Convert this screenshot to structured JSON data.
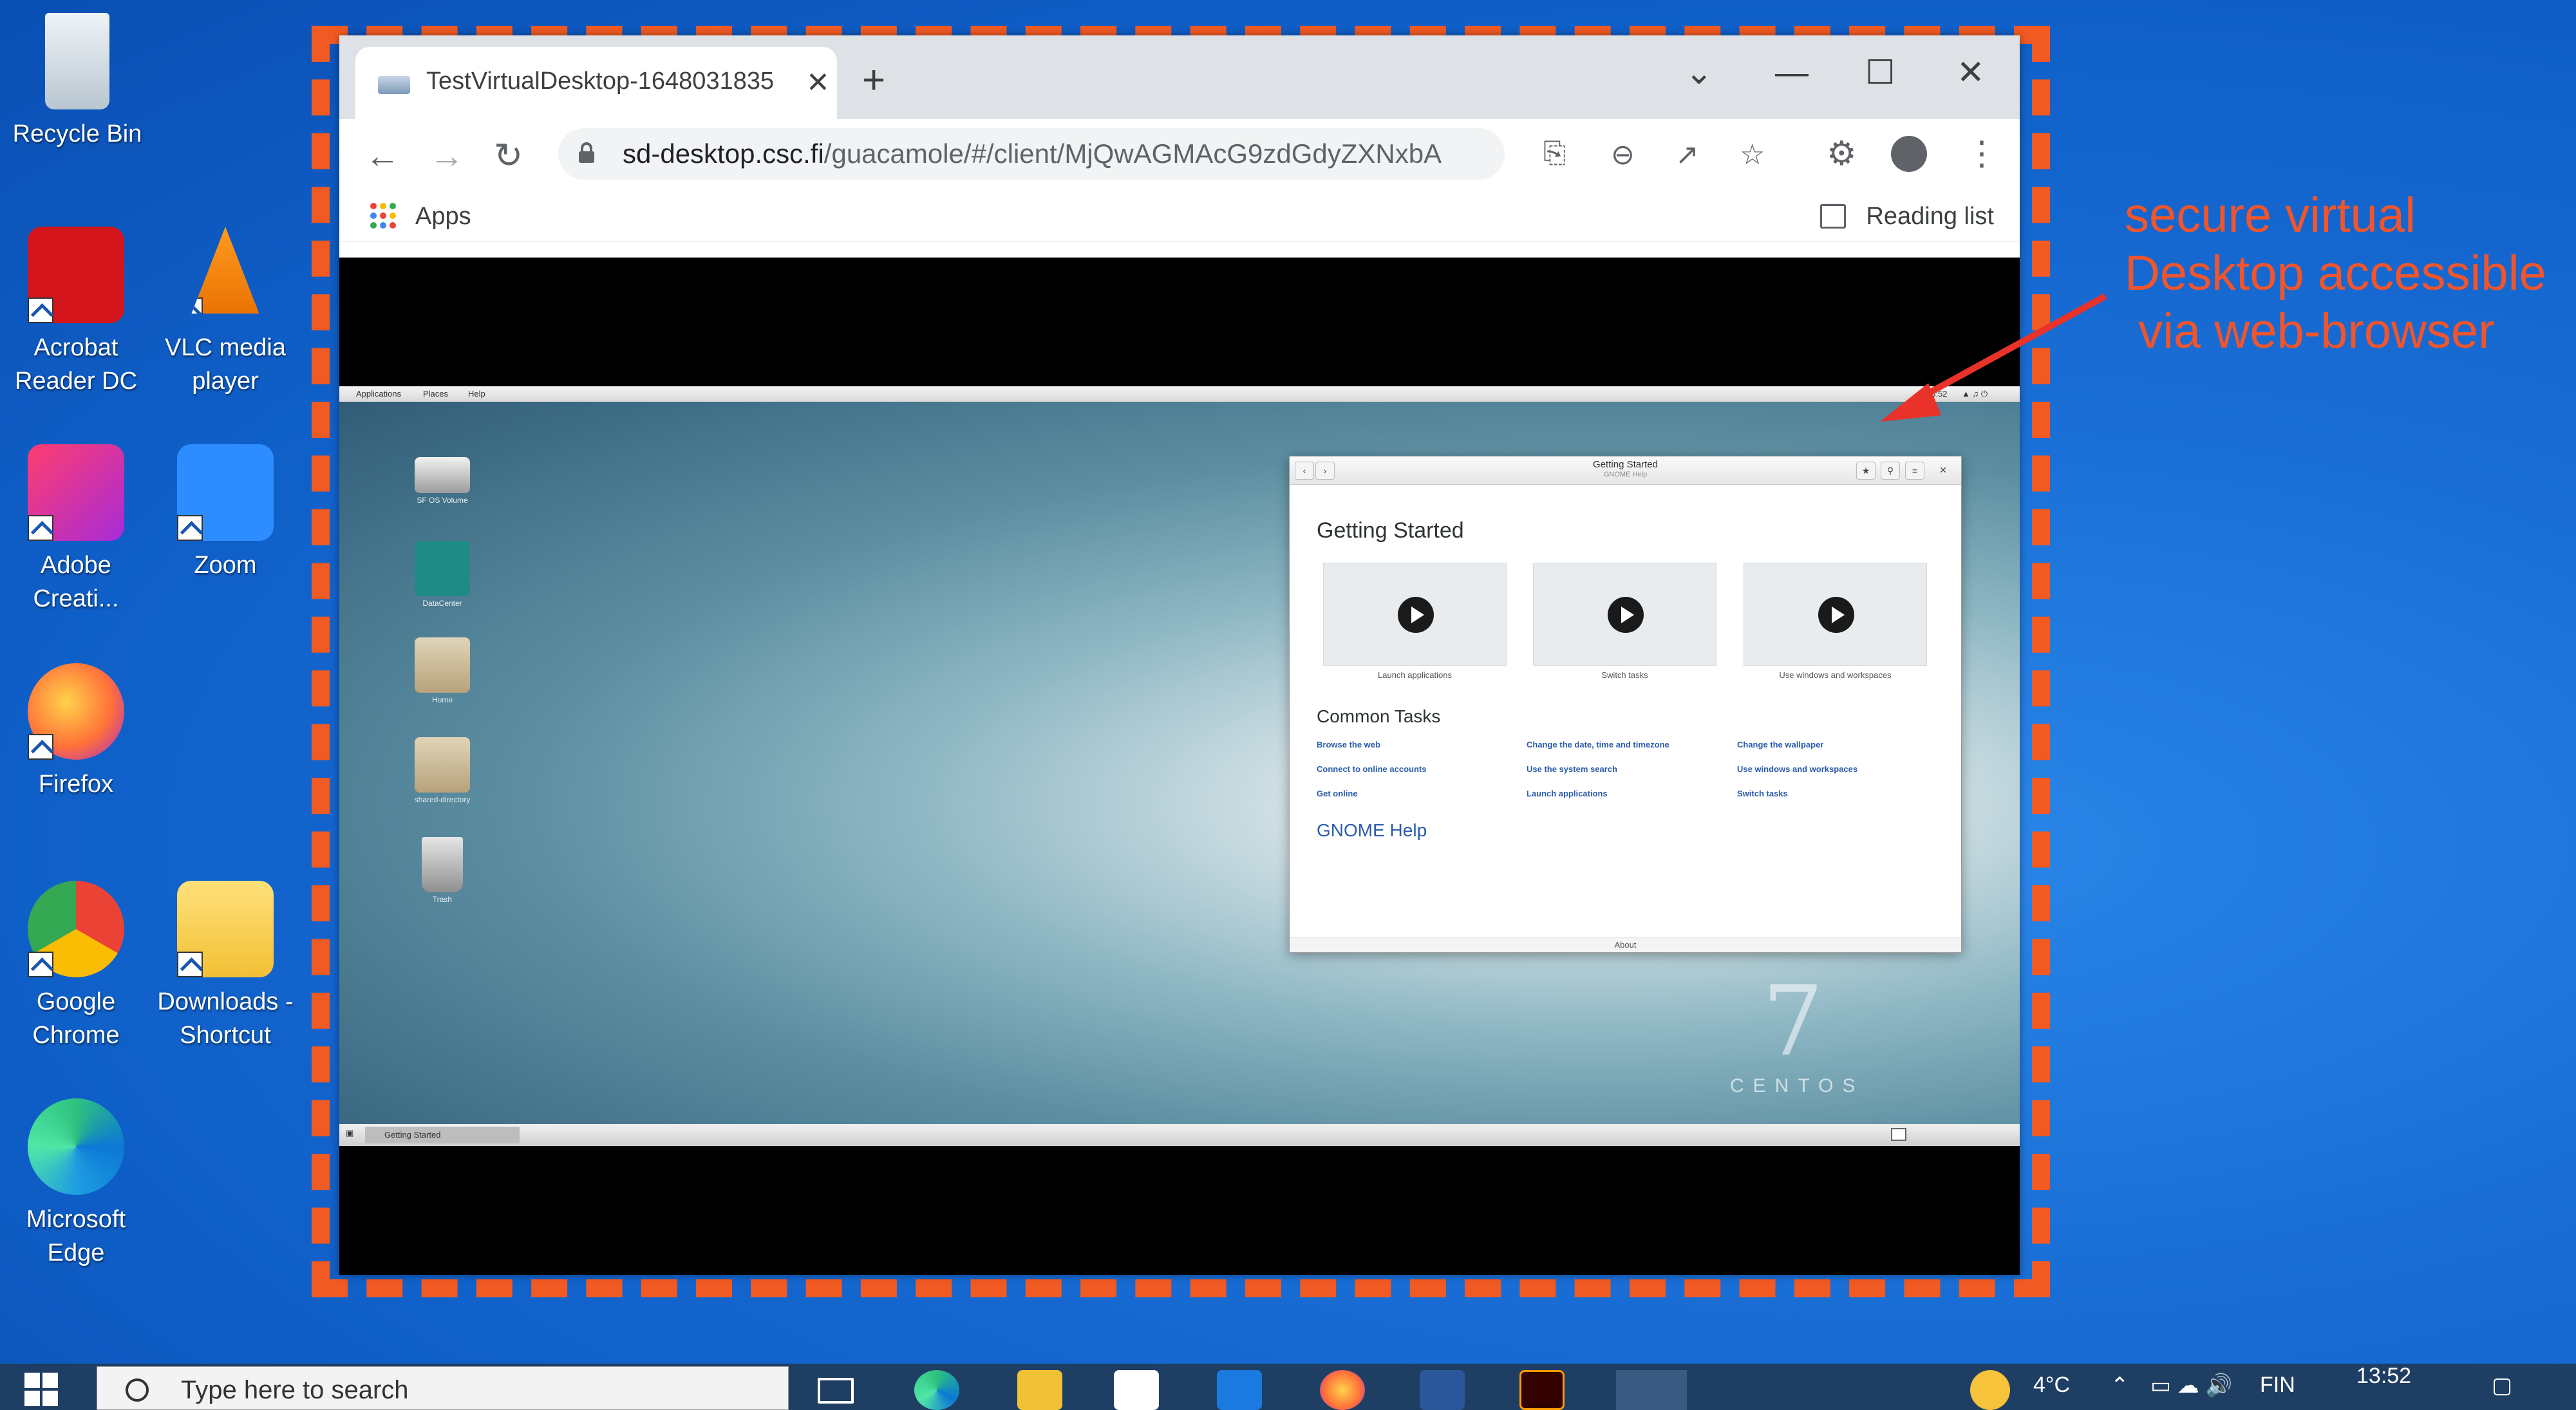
{
  "desktop": {
    "icons": [
      {
        "label": "Recycle Bin"
      },
      {
        "label": "Acrobat Reader DC"
      },
      {
        "label": "VLC media player"
      },
      {
        "label": "Adobe Creati..."
      },
      {
        "label": "Zoom"
      },
      {
        "label": "Firefox"
      },
      {
        "label": "Google Chrome"
      },
      {
        "label": "Downloads - Shortcut"
      },
      {
        "label": "Microsoft Edge"
      }
    ]
  },
  "browser": {
    "tab_title": "TestVirtualDesktop-1648031835",
    "tab_close": "✕",
    "new_tab": "+",
    "window_controls": {
      "tabsearch": "⌄",
      "minimize": "—",
      "maximize": "☐",
      "close": "✕"
    },
    "nav": {
      "back": "←",
      "forward": "→",
      "reload": "↻"
    },
    "url_host": "sd-desktop.csc.fi",
    "url_path": "/guacamole/#/client/MjQwAGMAcG9zdGdyZXNxbA",
    "bookmarks": {
      "apps": "Apps",
      "reading_list": "Reading list"
    },
    "apps_colors": [
      "#ea4335",
      "#fbbc04",
      "#34a853",
      "#4285f4",
      "#ea4335",
      "#fbbc04",
      "#34a853",
      "#4285f4",
      "#ea4335"
    ]
  },
  "remote": {
    "top_menu": {
      "applications": "Applications",
      "places": "Places",
      "help": "Help",
      "clock": "13:52"
    },
    "desktop_icons": [
      {
        "label": "SF OS Volume"
      },
      {
        "label": "DataCenter"
      },
      {
        "label": "Home"
      },
      {
        "label": "shared-directory"
      },
      {
        "label": "Trash"
      }
    ],
    "help_window": {
      "title": "Getting Started",
      "subtitle": "GNOME Help",
      "heading": "Getting Started",
      "videos": [
        "Launch applications",
        "Switch tasks",
        "Use windows and workspaces"
      ],
      "common_tasks_heading": "Common Tasks",
      "tasks": [
        "Browse the web",
        "Change the date, time and timezone",
        "Change the wallpaper",
        "Connect to online accounts",
        "Use the system search",
        "Use windows and workspaces",
        "Get online",
        "Launch applications",
        "Switch tasks"
      ],
      "gnome_help": "GNOME Help",
      "about": "About"
    },
    "taskbar_item": "Getting Started",
    "branding": {
      "seven": "7",
      "word": "CENTOS"
    }
  },
  "annotation": {
    "lines": [
      "secure virtual",
      "Desktop accessible",
      " via web-browser"
    ],
    "color": "#f2552b"
  },
  "taskbar": {
    "search_placeholder": "Type here to search",
    "weather": "4°C",
    "language": "FIN",
    "time": "13:52"
  }
}
